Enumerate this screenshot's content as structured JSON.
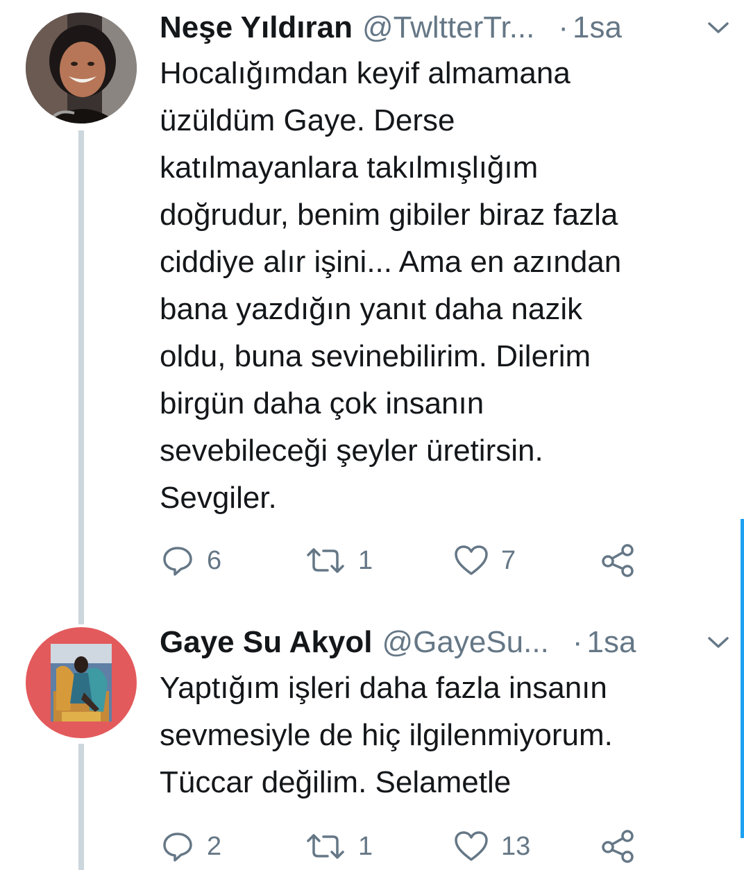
{
  "tweets": [
    {
      "name": "Neşe Yıldıran",
      "handle": "@TwltterTr...",
      "separator": "·",
      "time": "1sa",
      "lines": [
        "Hocalığımdan keyif almamana",
        "üzüldüm Gaye. Derse",
        "katılmayanlara takılmışlığım",
        "doğrudur, benim gibiler biraz fazla",
        "ciddiye alır işini... Ama en azından",
        "bana yazdığın yanıt daha nazik",
        "oldu, buna sevinebilirim. Dilerim",
        "birgün daha çok insanın",
        "sevebileceği şeyler üretirsin.",
        "Sevgiler."
      ],
      "replies": "6",
      "retweets": "1",
      "likes": "7",
      "avatar_icon": "user-avatar-photo"
    },
    {
      "name": "Gaye Su Akyol",
      "handle": "@GayeSu...",
      "separator": "·",
      "time": "1sa",
      "lines": [
        "Yaptığım işleri daha fazla insanın",
        "sevmesiyle de hiç ilgilenmiyorum.",
        "Tüccar değilim. Selametle"
      ],
      "replies": "2",
      "retweets": "1",
      "likes": "13",
      "avatar_icon": "user-avatar-photo"
    }
  ],
  "colors": {
    "text": "#14171a",
    "muted": "#657786",
    "thread_line": "#ccd6dd",
    "accent": "#1da1f2"
  }
}
